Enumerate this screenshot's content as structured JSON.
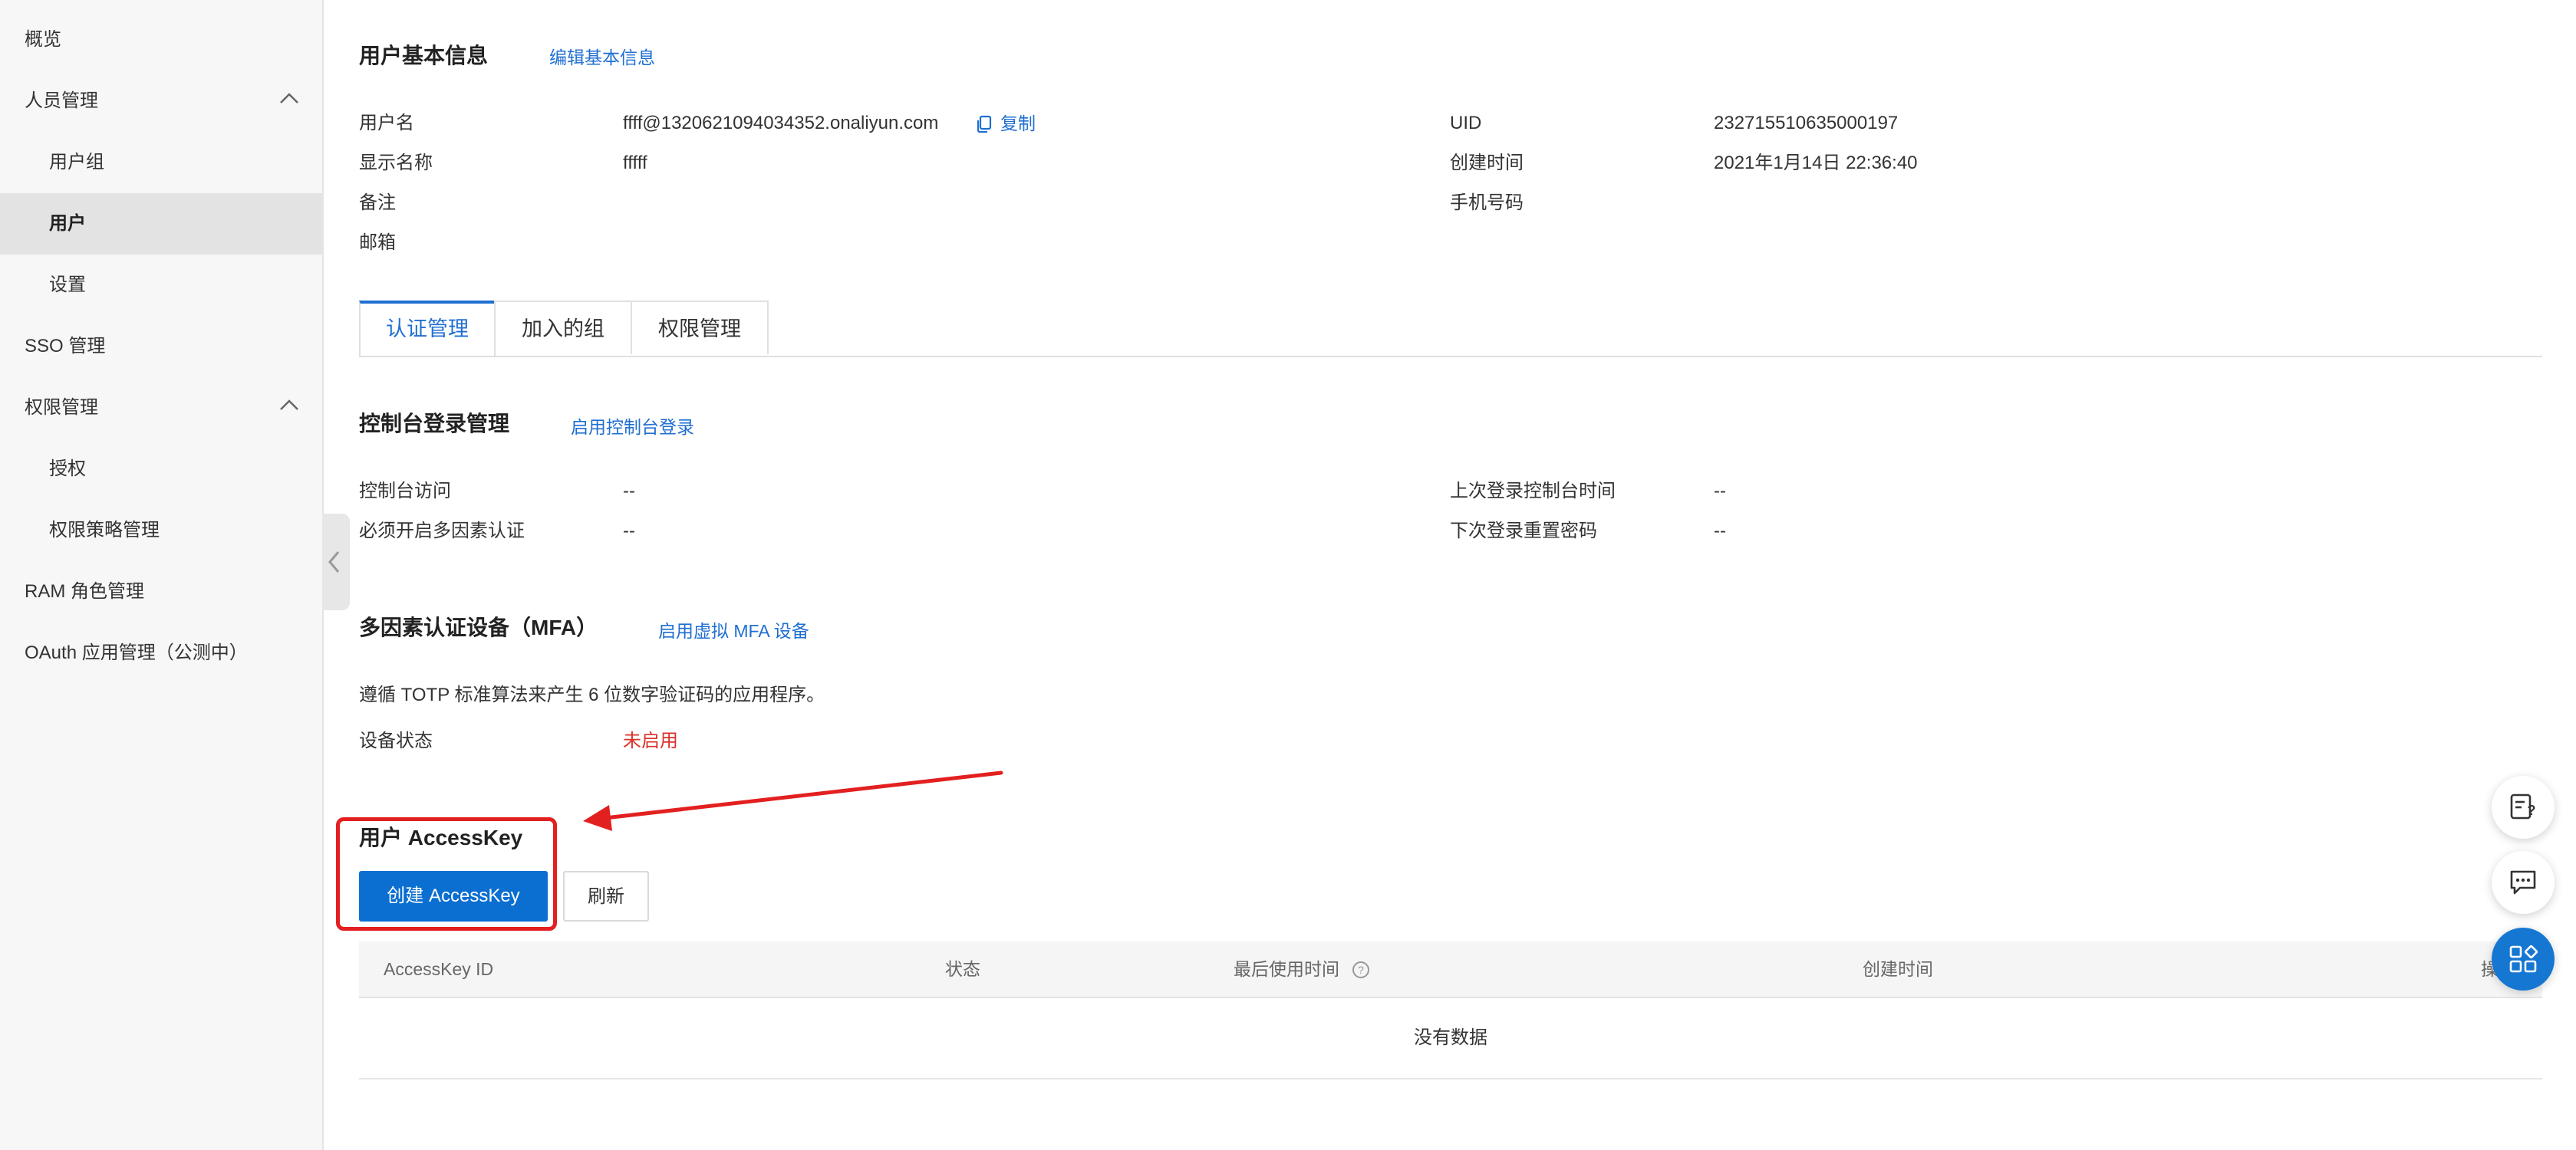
{
  "sidebar": {
    "items": [
      {
        "label": "概览"
      },
      {
        "label": "人员管理"
      },
      {
        "label": "用户组"
      },
      {
        "label": "用户"
      },
      {
        "label": "设置"
      },
      {
        "label": "SSO 管理"
      },
      {
        "label": "权限管理"
      },
      {
        "label": "授权"
      },
      {
        "label": "权限策略管理"
      },
      {
        "label": "RAM 角色管理"
      },
      {
        "label": "OAuth 应用管理（公测中）"
      }
    ]
  },
  "basic_info": {
    "title": "用户基本信息",
    "edit_link": "编辑基本信息",
    "username_label": "用户名",
    "username_value": "ffff@1320621094034352.onaliyun.com",
    "copy_label": "复制",
    "display_name_label": "显示名称",
    "display_name_value": "fffff",
    "note_label": "备注",
    "email_label": "邮箱",
    "uid_label": "UID",
    "uid_value": "232715510635000197",
    "created_label": "创建时间",
    "created_value": "2021年1月14日 22:36:40",
    "phone_label": "手机号码"
  },
  "tabs": [
    {
      "label": "认证管理"
    },
    {
      "label": "加入的组"
    },
    {
      "label": "权限管理"
    }
  ],
  "console_login": {
    "title": "控制台登录管理",
    "enable_link": "启用控制台登录",
    "access_label": "控制台访问",
    "access_value": "--",
    "mfa_required_label": "必须开启多因素认证",
    "mfa_required_value": "--",
    "last_login_label": "上次登录控制台时间",
    "last_login_value": "--",
    "reset_pwd_label": "下次登录重置密码",
    "reset_pwd_value": "--"
  },
  "mfa": {
    "title": "多因素认证设备（MFA）",
    "enable_link": "启用虚拟 MFA 设备",
    "description": "遵循 TOTP 标准算法来产生 6 位数字验证码的应用程序。",
    "status_label": "设备状态",
    "status_value": "未启用",
    "status_color": "#d9312b"
  },
  "accesskey": {
    "title": "用户 AccessKey",
    "create_button": "创建 AccessKey",
    "refresh_button": "刷新",
    "columns": [
      "AccessKey ID",
      "状态",
      "最后使用时间",
      "创建时间",
      "操"
    ],
    "empty_text": "没有数据"
  },
  "colors": {
    "accent": "#1f6fd1",
    "primary_button": "#0b6fd1",
    "annotation": "#e32020"
  }
}
